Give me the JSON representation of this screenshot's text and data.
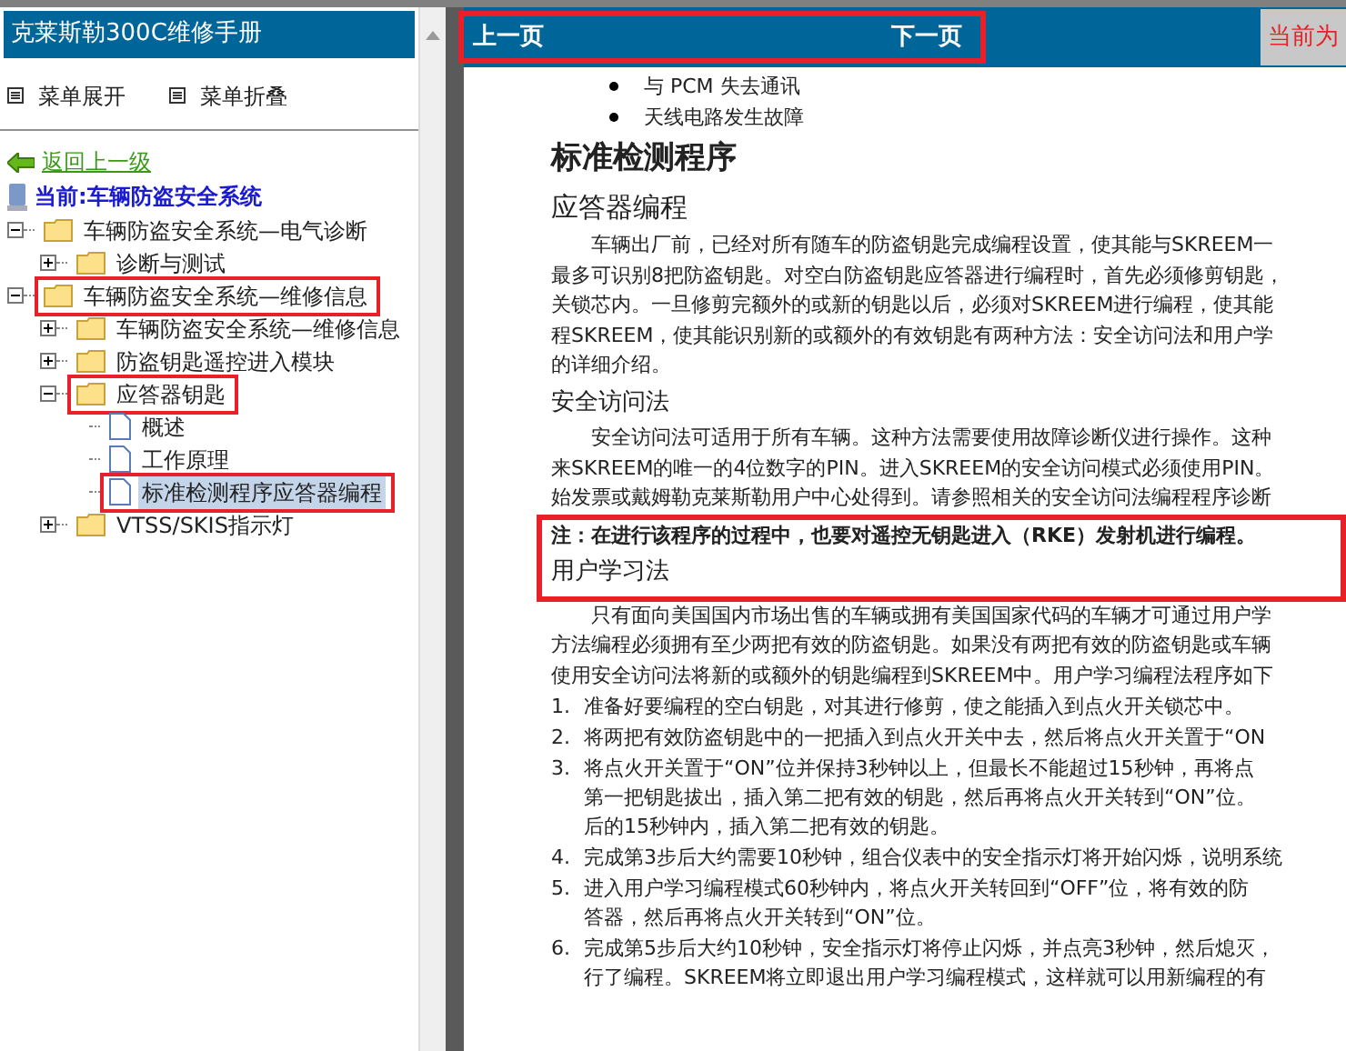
{
  "sidebar": {
    "title": "克莱斯勒300C维修手册",
    "menu_buttons": [
      {
        "label": "菜单展开"
      },
      {
        "label": "菜单折叠"
      }
    ],
    "back_link": "返回上一级",
    "current": "当前:车辆防盗安全系统",
    "tree": [
      {
        "label": "车辆防盗安全系统—电气诊断",
        "kind": "folder",
        "expanded": true,
        "selected": false,
        "annotated": false,
        "children": [
          {
            "label": "诊断与测试",
            "kind": "folder",
            "expanded": false,
            "selected": false,
            "annotated": false
          }
        ]
      },
      {
        "label": "车辆防盗安全系统—维修信息",
        "kind": "folder",
        "expanded": true,
        "selected": false,
        "annotated": true,
        "children": [
          {
            "label": "车辆防盗安全系统—维修信息",
            "kind": "folder",
            "expanded": false,
            "selected": false,
            "annotated": false
          },
          {
            "label": "防盗钥匙遥控进入模块",
            "kind": "folder",
            "expanded": false,
            "selected": false,
            "annotated": false
          },
          {
            "label": "应答器钥匙",
            "kind": "folder",
            "expanded": true,
            "selected": false,
            "annotated": true,
            "children": [
              {
                "label": "概述",
                "kind": "doc",
                "selected": false,
                "annotated": false
              },
              {
                "label": "工作原理",
                "kind": "doc",
                "selected": false,
                "annotated": false
              },
              {
                "label": "标准检测程序应答器编程",
                "kind": "doc",
                "selected": true,
                "annotated": true
              }
            ]
          },
          {
            "label": "VTSS/SKIS指示灯",
            "kind": "folder",
            "expanded": false,
            "selected": false,
            "annotated": false
          }
        ]
      }
    ]
  },
  "topbar": {
    "annotated": true,
    "prev": "上一页",
    "next": "下一页",
    "current_label": "当前为"
  },
  "document": {
    "blocks": [
      {
        "kind": "bullet",
        "text": "与 PCM 失去通讯"
      },
      {
        "kind": "bullet",
        "text": "天线电路发生故障"
      },
      {
        "kind": "h1",
        "text": "标准检测程序"
      },
      {
        "kind": "h2",
        "text": "应答器编程"
      },
      {
        "kind": "para",
        "lines": [
          "车辆出厂前，已经对所有随车的防盗钥匙完成编程设置，使其能与SKREEM一",
          "最多可识别8把防盗钥匙。对空白防盗钥匙应答器进行编程时，首先必须修剪钥匙，",
          "关锁芯内。一旦修剪完额外的或新的钥匙以后，必须对SKREEM进行编程，使其能",
          "程SKREEM，使其能识别新的或额外的有效钥匙有两种方法：安全访问法和用户学",
          "的详细介绍。"
        ]
      },
      {
        "kind": "h3",
        "text": "安全访问法"
      },
      {
        "kind": "para",
        "lines": [
          "安全访问法可适用于所有车辆。这种方法需要使用故障诊断仪进行操作。这种",
          "来SKREEM的唯一的4位数字的PIN。进入SKREEM的安全访问模式必须使用PIN。",
          "始发票或戴姆勒克莱斯勒用户中心处得到。请参照相关的安全访问法编程程序诊断"
        ]
      },
      {
        "kind": "group",
        "annotated": true,
        "blocks": [
          {
            "kind": "note",
            "text": "注：在进行该程序的过程中，也要对遥控无钥匙进入（RKE）发射机进行编程。"
          },
          {
            "kind": "h3",
            "text": "用户学习法"
          }
        ]
      },
      {
        "kind": "para",
        "lines": [
          "只有面向美国国内市场出售的车辆或拥有美国国家代码的车辆才可通过用户学",
          "方法编程必须拥有至少两把有效的防盗钥匙。如果没有两把有效的防盗钥匙或车辆",
          "使用安全访问法将新的或额外的钥匙编程到SKREEM中。用户学习编程法程序如下"
        ]
      },
      {
        "kind": "step",
        "number": "1.",
        "lines": [
          "准备好要编程的空白钥匙，对其进行修剪，使之能插入到点火开关锁芯中。"
        ]
      },
      {
        "kind": "step",
        "number": "2.",
        "lines": [
          "将两把有效防盗钥匙中的一把插入到点火开关中去，然后将点火开关置于“ON"
        ]
      },
      {
        "kind": "step",
        "number": "3.",
        "lines": [
          "将点火开关置于“ON”位并保持3秒钟以上，但最长不能超过15秒钟，再将点",
          "第一把钥匙拔出，插入第二把有效的钥匙，然后再将点火开关转到“ON”位。",
          "后的15秒钟内，插入第二把有效的钥匙。"
        ]
      },
      {
        "kind": "step",
        "number": "4.",
        "lines": [
          "完成第3步后大约需要10秒钟，组合仪表中的安全指示灯将开始闪烁，说明系统"
        ]
      },
      {
        "kind": "step",
        "number": "5.",
        "lines": [
          "进入用户学习编程模式60秒钟内，将点火开关转回到“OFF”位，将有效的防",
          "答器，然后再将点火开关转到“ON”位。"
        ]
      },
      {
        "kind": "step",
        "number": "6.",
        "lines": [
          "完成第5步后大约10秒钟，安全指示灯将停止闪烁，并点亮3秒钟，然后熄灭，",
          "行了编程。SKREEM将立即退出用户学习编程模式，这样就可以用新编程的有"
        ]
      }
    ]
  }
}
